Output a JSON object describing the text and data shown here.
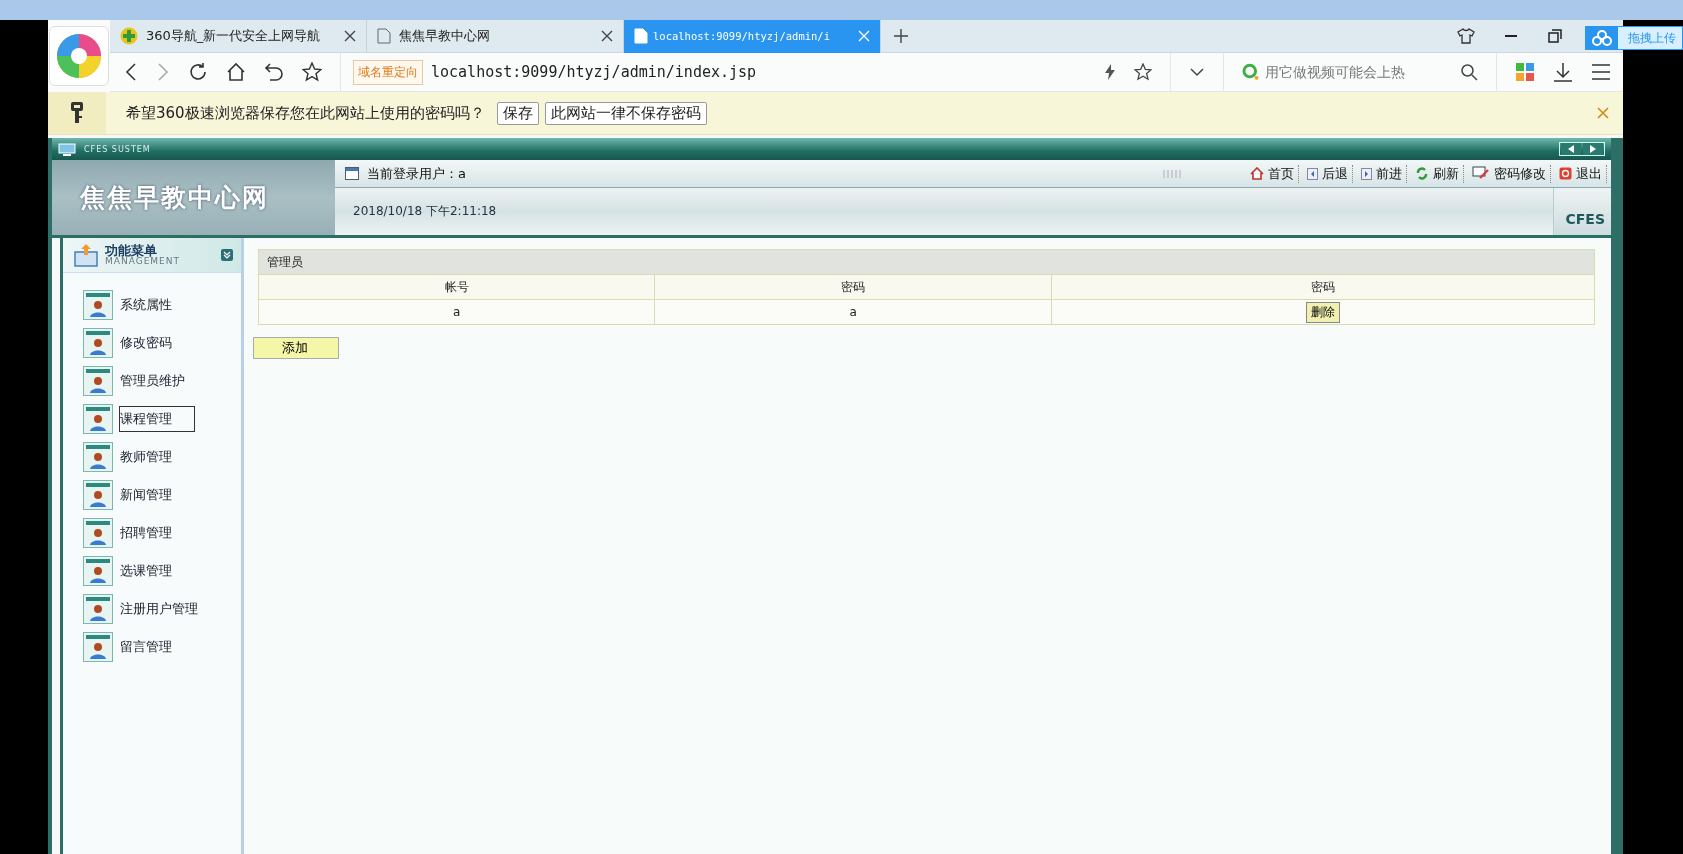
{
  "browser": {
    "tabs": [
      {
        "title": "360导航_新一代安全上网导航",
        "kind": "site",
        "selected": false
      },
      {
        "title": "焦焦早教中心网",
        "kind": "page",
        "selected": false
      },
      {
        "title": "localhost:9099/htyzj/admin/i",
        "kind": "page",
        "selected": true
      }
    ],
    "address": {
      "badge": "域名重定向",
      "url": "localhost:9099/htyzj/admin/index.jsp"
    },
    "search": {
      "placeholder": "用它做视频可能会上热"
    },
    "upload_button": "拖拽上传"
  },
  "password_bar": {
    "message": "希望360极速浏览器保存您在此网站上使用的密码吗？",
    "buttons": [
      "保存",
      "此网站一律不保存密码"
    ]
  },
  "app": {
    "title": "CFES SUSTEM",
    "site_name": "焦焦早教中心网",
    "user_label": "当前登录用户：a",
    "datetime": "2018/10/18 下午2:11:18",
    "brand": "CFES",
    "nav": [
      {
        "label": "首页",
        "kind": "home"
      },
      {
        "label": "后退",
        "kind": "back"
      },
      {
        "label": "前进",
        "kind": "forward"
      },
      {
        "label": "刷新",
        "kind": "refresh"
      },
      {
        "label": "密码修改",
        "kind": "edit"
      },
      {
        "label": "退出",
        "kind": "exit"
      }
    ]
  },
  "menu": {
    "title": "功能菜单",
    "subtitle": "MANAGEMENT",
    "items": [
      {
        "label": "系统属性",
        "selected": false
      },
      {
        "label": "修改密码",
        "selected": false
      },
      {
        "label": "管理员维护",
        "selected": false
      },
      {
        "label": "课程管理",
        "selected": true
      },
      {
        "label": "教师管理",
        "selected": false
      },
      {
        "label": "新闻管理",
        "selected": false
      },
      {
        "label": "招聘管理",
        "selected": false
      },
      {
        "label": "选课管理",
        "selected": false
      },
      {
        "label": "注册用户管理",
        "selected": false
      },
      {
        "label": "留言管理",
        "selected": false
      }
    ]
  },
  "panel": {
    "title": "管理员",
    "columns": [
      "帐号",
      "密码",
      "密码"
    ],
    "rows": [
      {
        "account": "a",
        "password": "a",
        "action": "删除"
      }
    ],
    "add_button": "添加"
  }
}
